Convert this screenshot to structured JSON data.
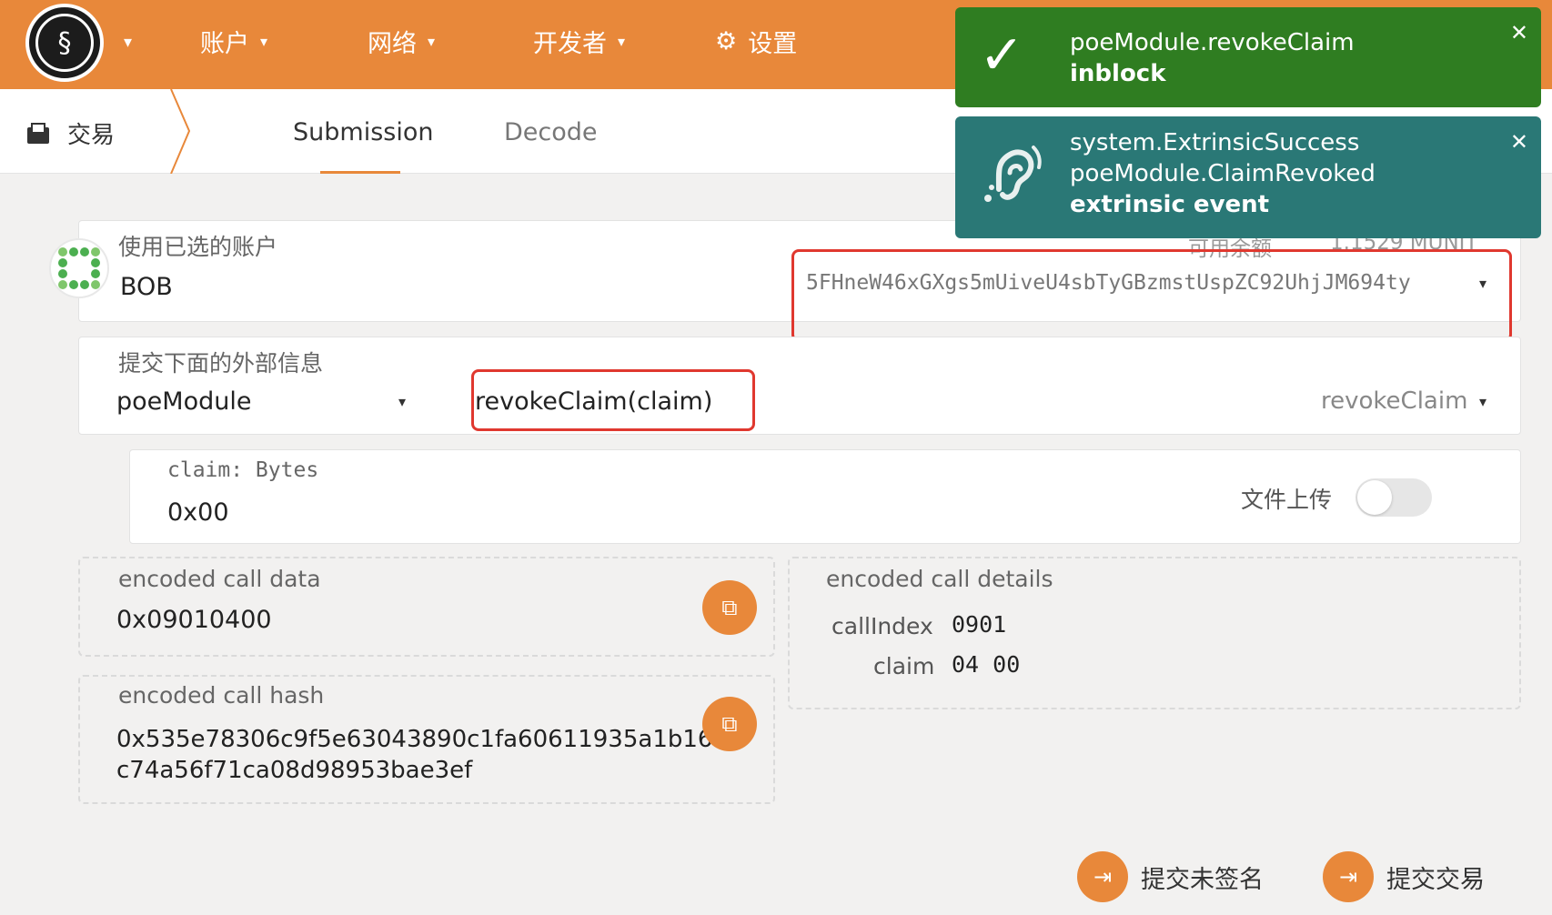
{
  "nav": {
    "items": [
      {
        "label": "账户"
      },
      {
        "label": "网络"
      },
      {
        "label": "开发者"
      },
      {
        "label": "设置"
      }
    ],
    "caret": "▾",
    "settings_icon": "⚙"
  },
  "subheader": {
    "title": "交易",
    "tabs": [
      {
        "label": "Submission",
        "active": true
      },
      {
        "label": "Decode",
        "active": false
      }
    ]
  },
  "account": {
    "label": "使用已选的账户",
    "name": "BOB",
    "balance_label": "可用余额",
    "balance_value": "1.1529 MUNIT",
    "address": "5FHneW46xGXgs5mUiveU4sbTyGBzmstUspZC92UhjJM694ty"
  },
  "extrinsic": {
    "label": "提交下面的外部信息",
    "module": "poeModule",
    "call_signature": "revokeClaim(claim)",
    "method": "revokeClaim"
  },
  "param": {
    "label": "claim: Bytes",
    "value": "0x00",
    "file_upload_label": "文件上传"
  },
  "encoded_call_data": {
    "label": "encoded call data",
    "value": "0x09010400"
  },
  "encoded_call_hash": {
    "label": "encoded call hash",
    "line1": "0x535e78306c9f5e63043890c1fa60611935a1b16",
    "line2": "c74a56f71ca08d98953bae3ef"
  },
  "encoded_call_details": {
    "label": "encoded call details",
    "rows": [
      {
        "key": "callIndex",
        "value": "0901"
      },
      {
        "key": "claim",
        "value": "04 00"
      }
    ]
  },
  "actions": {
    "unsigned": "提交未签名",
    "submit": "提交交易"
  },
  "notifications": [
    {
      "line1": "poeModule.revokeClaim",
      "line2": "inblock",
      "color": "#2f7d21",
      "icon": "checkmark-icon"
    },
    {
      "line1": "system.ExtrinsicSuccess",
      "line2": "poeModule.ClaimRevoked",
      "line3": "extrinsic event",
      "color": "#2a7876",
      "icon": "ear-icon"
    }
  ],
  "colors": {
    "accent": "#e8883a",
    "highlight": "#e0382f"
  }
}
